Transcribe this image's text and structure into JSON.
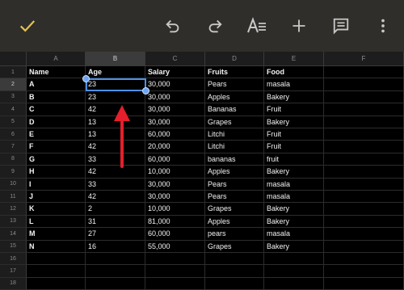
{
  "colors": {
    "toolbar_bg": "#2f2e2a",
    "accent_check": "#e2c255",
    "selection": "#4f8fe6",
    "arrow": "#e51f2c"
  },
  "toolbar": {
    "icons": [
      "checkmark-icon",
      "undo-icon",
      "redo-icon",
      "text-format-icon",
      "add-icon",
      "comment-icon",
      "more-vert-icon"
    ]
  },
  "sheet": {
    "column_headers": [
      "A",
      "B",
      "C",
      "D",
      "E",
      "F"
    ],
    "row_numbers": [
      "1",
      "2",
      "3",
      "4",
      "5",
      "6",
      "7",
      "8",
      "9",
      "10",
      "11",
      "12",
      "13",
      "14",
      "15",
      "16",
      "17",
      "18"
    ],
    "selected_cell": "B2",
    "rows": [
      [
        "Name",
        "Age",
        "Salary",
        "Fruits",
        "Food"
      ],
      [
        "A",
        "23",
        "30,000",
        "Pears",
        "masala"
      ],
      [
        "B",
        "23",
        "30,000",
        "Apples",
        "Bakery"
      ],
      [
        "C",
        "42",
        "30,000",
        "Bananas",
        "Fruit"
      ],
      [
        "D",
        "13",
        "30,000",
        "Grapes",
        "Bakery"
      ],
      [
        "E",
        "13",
        "60,000",
        "Litchi",
        "Fruit"
      ],
      [
        "F",
        "42",
        "20,000",
        "Litchi",
        "Fruit"
      ],
      [
        "G",
        "33",
        "60,000",
        "bananas",
        "fruit"
      ],
      [
        "H",
        "42",
        "10,000",
        "Apples",
        "Bakery"
      ],
      [
        "I",
        "33",
        "30,000",
        "Pears",
        "masala"
      ],
      [
        "J",
        "42",
        "30,000",
        "Pears",
        "masala"
      ],
      [
        "K",
        "2",
        "10,000",
        "Grapes",
        "Bakery"
      ],
      [
        "L",
        "31",
        "81,000",
        "Apples",
        "Bakery"
      ],
      [
        "M",
        "27",
        "60,000",
        "pears",
        "masala"
      ],
      [
        "N",
        "16",
        "55,000",
        "Grapes",
        "Bakery"
      ]
    ]
  }
}
